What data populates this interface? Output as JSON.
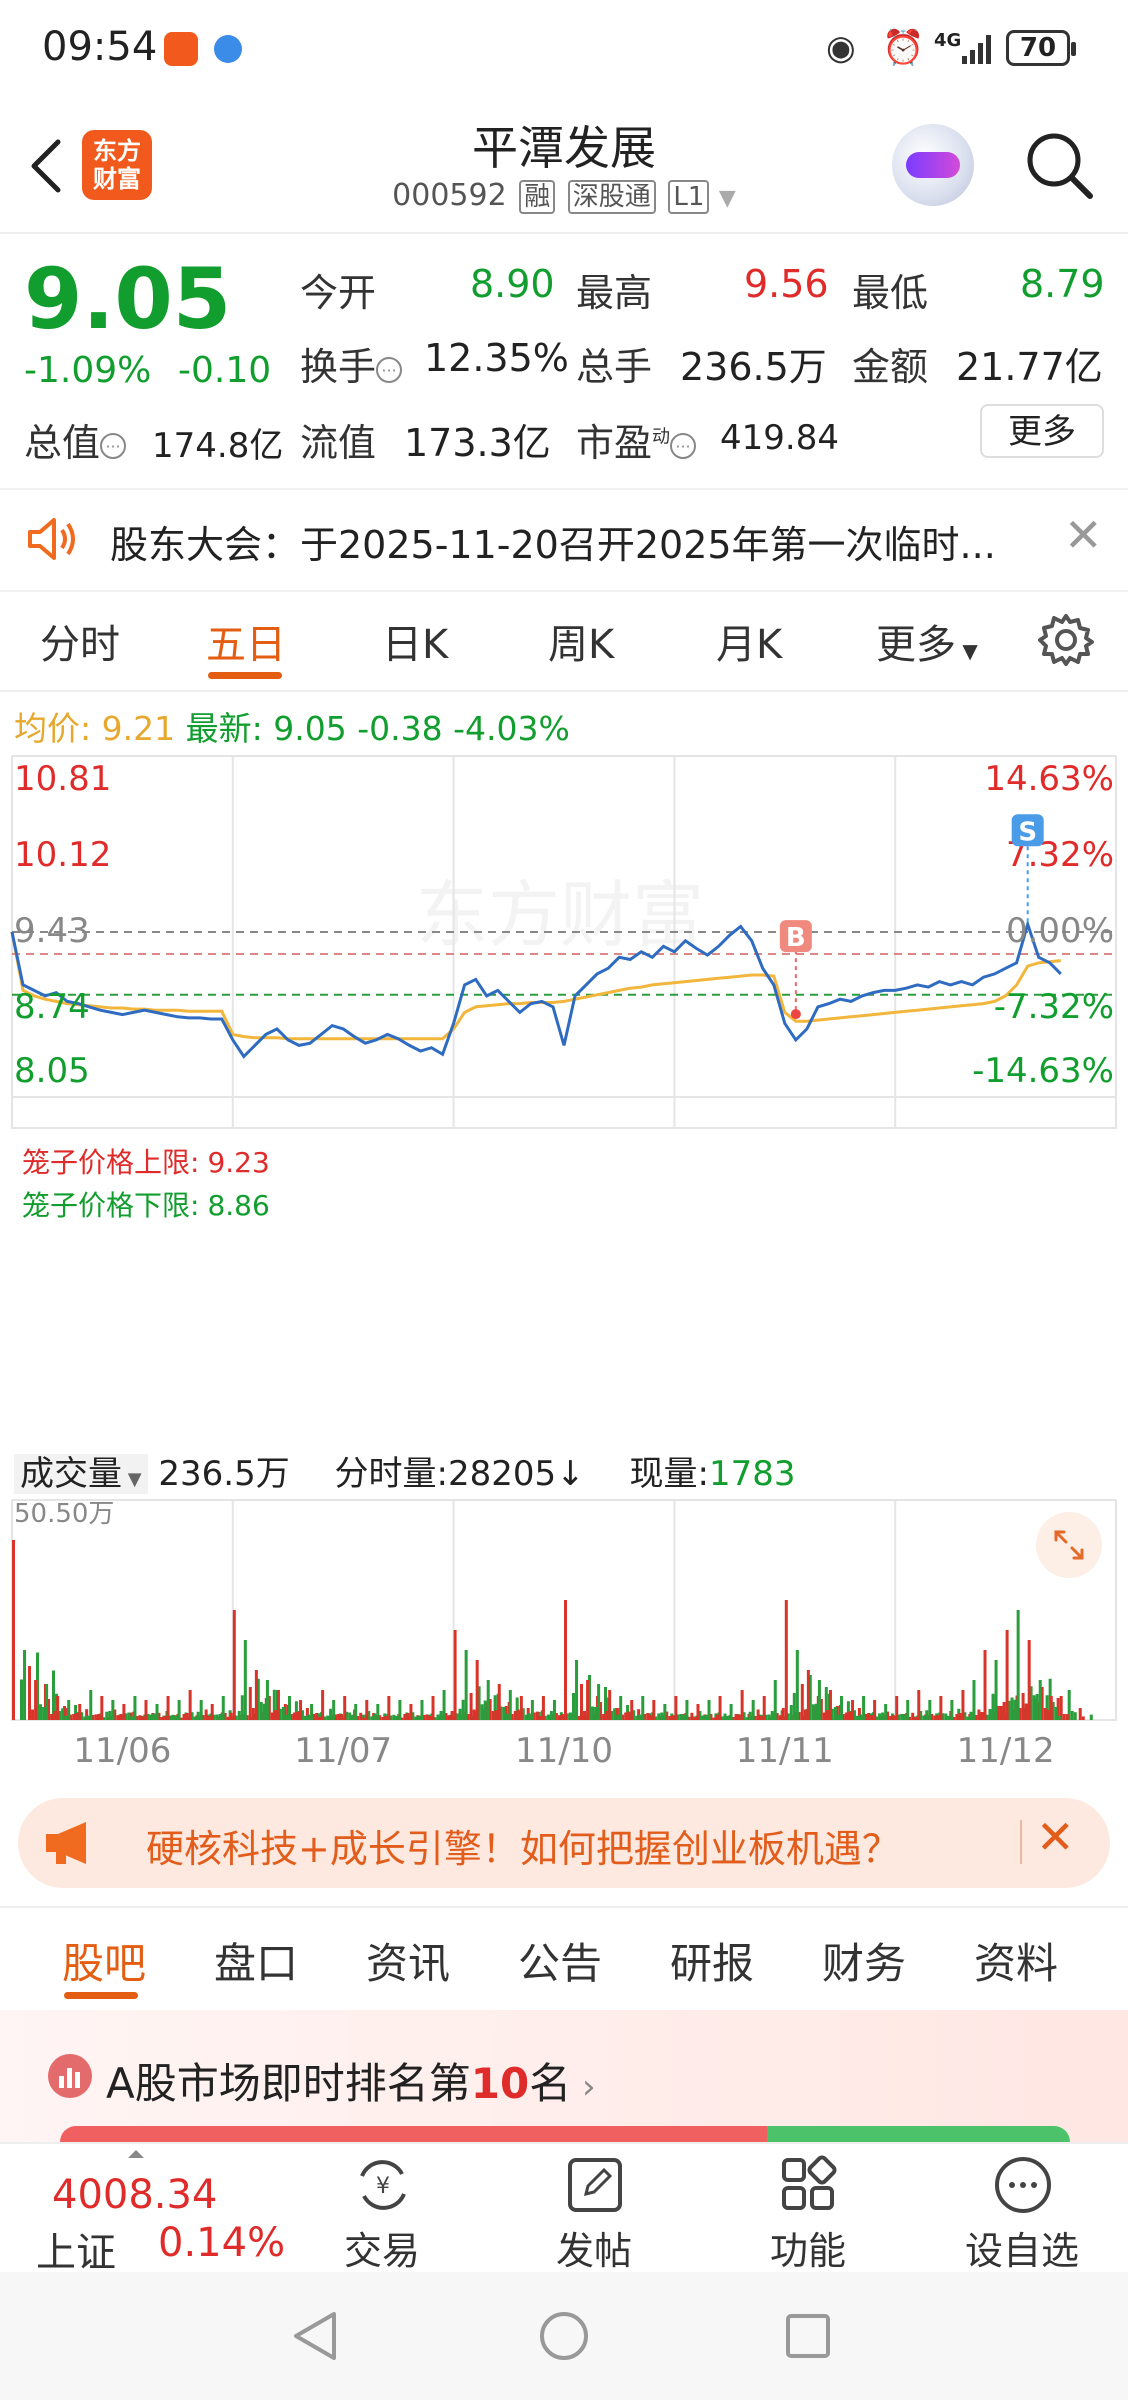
{
  "status_bar": {
    "time": "09:54",
    "network": "4G",
    "battery": "70"
  },
  "header": {
    "title": "平潭发展",
    "code": "000592",
    "tags": [
      "融",
      "深股通",
      "L1"
    ],
    "logo_text": "东方\n财富"
  },
  "quote": {
    "price": "9.05",
    "change_pct": "-1.09%",
    "change": "-0.10",
    "open_label": "今开",
    "open": "8.90",
    "high_label": "最高",
    "high": "9.56",
    "low_label": "最低",
    "low": "8.79",
    "turnover_label": "换手",
    "turnover": "12.35%",
    "volume_label": "总手",
    "volume": "236.5万",
    "amount_label": "金额",
    "amount": "21.77亿",
    "mktcap_label": "总值",
    "mktcap": "174.8亿",
    "float_label": "流值",
    "float": "173.3亿",
    "pe_label": "市盈",
    "pe_sup": "动",
    "pe": "419.84",
    "more_label": "更多"
  },
  "notice": {
    "text": "股东大会：于2025-11-20召开2025年第一次临时..."
  },
  "tabs": [
    "分时",
    "五日",
    "日K",
    "周K",
    "月K",
    "更多"
  ],
  "legend": {
    "avg_label": "均价:",
    "avg": "9.21",
    "last_label": "最新:",
    "last": "9.05",
    "chg": "-0.38",
    "chg_pct": "-4.03%"
  },
  "chart_data": {
    "type": "line",
    "title": "",
    "y_left_ticks": [
      "10.81",
      "10.12",
      "9.43",
      "8.74",
      "8.05"
    ],
    "y_right_ticks": [
      "14.63%",
      "7.32%",
      "0.00%",
      "-7.32%",
      "-14.63%"
    ],
    "ylim": [
      8.05,
      10.81
    ],
    "x_labels": [
      "11/06",
      "11/07",
      "11/10",
      "11/11",
      "11/12"
    ],
    "limit_upper_label": "笼子价格上限:",
    "limit_upper": "9.23",
    "limit_lower_label": "笼子价格下限:",
    "limit_lower": "8.86",
    "markers": [
      {
        "label": "B",
        "value": 8.83
      },
      {
        "label": "S",
        "value": 9.5
      }
    ],
    "watermark": "东方财富",
    "series": [
      {
        "name": "",
        "color": "#2e6bc1",
        "values": [
          9.43,
          8.95,
          8.9,
          8.85,
          8.88,
          8.8,
          8.78,
          8.75,
          8.72,
          8.7,
          8.68,
          8.7,
          8.72,
          8.7,
          8.68,
          8.66,
          8.65,
          8.65,
          8.64,
          8.64,
          8.45,
          8.3,
          8.4,
          8.5,
          8.55,
          8.45,
          8.4,
          8.42,
          8.5,
          8.58,
          8.55,
          8.48,
          8.42,
          8.45,
          8.5,
          8.46,
          8.4,
          8.35,
          8.38,
          8.32,
          8.6,
          8.95,
          9.0,
          8.85,
          8.9,
          8.8,
          8.7,
          8.78,
          8.8,
          8.75,
          8.4,
          8.85,
          8.95,
          9.05,
          9.1,
          9.2,
          9.18,
          9.25,
          9.2,
          9.3,
          9.25,
          9.35,
          9.28,
          9.22,
          9.3,
          9.4,
          9.48,
          9.35,
          9.1,
          8.95,
          8.6,
          8.45,
          8.55,
          8.75,
          8.78,
          8.82,
          8.8,
          8.85,
          8.88,
          8.9,
          8.9,
          8.92,
          8.95,
          8.93,
          8.98,
          8.95,
          8.98,
          8.95,
          9.02,
          9.05,
          9.1,
          9.15,
          9.5,
          9.2,
          9.15,
          9.05
        ]
      },
      {
        "name": "",
        "color": "#f2b63c",
        "values": [
          9.43,
          8.9,
          8.85,
          8.82,
          8.8,
          8.78,
          8.77,
          8.76,
          8.75,
          8.74,
          8.74,
          8.73,
          8.73,
          8.72,
          8.72,
          8.72,
          8.71,
          8.71,
          8.71,
          8.71,
          8.5,
          8.48,
          8.47,
          8.47,
          8.47,
          8.46,
          8.46,
          8.46,
          8.46,
          8.46,
          8.46,
          8.46,
          8.46,
          8.46,
          8.46,
          8.46,
          8.46,
          8.46,
          8.46,
          8.46,
          8.55,
          8.7,
          8.75,
          8.76,
          8.77,
          8.78,
          8.78,
          8.79,
          8.79,
          8.79,
          8.8,
          8.82,
          8.84,
          8.86,
          8.88,
          8.9,
          8.92,
          8.93,
          8.95,
          8.96,
          8.97,
          8.98,
          8.99,
          9.0,
          9.01,
          9.02,
          9.03,
          9.04,
          9.04,
          9.03,
          8.7,
          8.62,
          8.62,
          8.63,
          8.64,
          8.65,
          8.66,
          8.67,
          8.68,
          8.69,
          8.7,
          8.71,
          8.72,
          8.73,
          8.74,
          8.75,
          8.76,
          8.77,
          8.78,
          8.8,
          8.85,
          8.95,
          9.12,
          9.15,
          9.16,
          9.17
        ]
      }
    ]
  },
  "volume": {
    "label": "成交量",
    "total": "236.5万",
    "minute_label": "分时量:",
    "minute": "28205",
    "now_label": "现量:",
    "now": "1783",
    "max_label": "50.50万",
    "bars": [
      0.9,
      0.35,
      0.2,
      0.18,
      0.12,
      0.1,
      0.08,
      0.15,
      0.12,
      0.1,
      0.08,
      0.12,
      0.1,
      0.08,
      0.12,
      0.1,
      0.15,
      0.1,
      0.08,
      0.12,
      0.55,
      0.4,
      0.25,
      0.2,
      0.15,
      0.12,
      0.1,
      0.08,
      0.15,
      0.1,
      0.12,
      0.08,
      0.1,
      0.08,
      0.12,
      0.1,
      0.08,
      0.1,
      0.12,
      0.15,
      0.45,
      0.35,
      0.3,
      0.2,
      0.18,
      0.15,
      0.12,
      0.1,
      0.12,
      0.1,
      0.6,
      0.3,
      0.2,
      0.18,
      0.15,
      0.12,
      0.1,
      0.12,
      0.1,
      0.08,
      0.12,
      0.1,
      0.08,
      0.1,
      0.12,
      0.08,
      0.15,
      0.1,
      0.12,
      0.2,
      0.6,
      0.35,
      0.25,
      0.2,
      0.15,
      0.12,
      0.1,
      0.12,
      0.1,
      0.08,
      0.12,
      0.1,
      0.15,
      0.1,
      0.12,
      0.1,
      0.15,
      0.2,
      0.35,
      0.3,
      0.45,
      0.55,
      0.4,
      0.2,
      0.12
    ]
  },
  "promo": {
    "text": "硬核科技+成长引擎！如何把握创业板机遇？"
  },
  "bottom_tabs": [
    "股吧",
    "盘口",
    "资讯",
    "公告",
    "研报",
    "财务",
    "资料"
  ],
  "rank": {
    "prefix": "A股市场即时排名第",
    "num": "10",
    "suffix": "名"
  },
  "bottom_nav": {
    "index_value": "4008.34",
    "index_name": "上证",
    "index_chg": "0.14%",
    "items": [
      "交易",
      "发帖",
      "功能",
      "设自选"
    ]
  }
}
